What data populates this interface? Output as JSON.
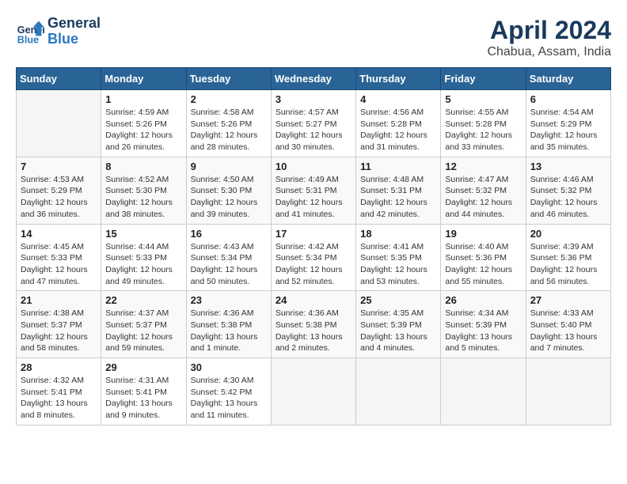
{
  "logo": {
    "line1": "General",
    "line2": "Blue"
  },
  "title": "April 2024",
  "subtitle": "Chabua, Assam, India",
  "days_header": [
    "Sunday",
    "Monday",
    "Tuesday",
    "Wednesday",
    "Thursday",
    "Friday",
    "Saturday"
  ],
  "weeks": [
    [
      {
        "num": "",
        "info": ""
      },
      {
        "num": "1",
        "info": "Sunrise: 4:59 AM\nSunset: 5:26 PM\nDaylight: 12 hours and 26 minutes."
      },
      {
        "num": "2",
        "info": "Sunrise: 4:58 AM\nSunset: 5:26 PM\nDaylight: 12 hours and 28 minutes."
      },
      {
        "num": "3",
        "info": "Sunrise: 4:57 AM\nSunset: 5:27 PM\nDaylight: 12 hours and 30 minutes."
      },
      {
        "num": "4",
        "info": "Sunrise: 4:56 AM\nSunset: 5:28 PM\nDaylight: 12 hours and 31 minutes."
      },
      {
        "num": "5",
        "info": "Sunrise: 4:55 AM\nSunset: 5:28 PM\nDaylight: 12 hours and 33 minutes."
      },
      {
        "num": "6",
        "info": "Sunrise: 4:54 AM\nSunset: 5:29 PM\nDaylight: 12 hours and 35 minutes."
      }
    ],
    [
      {
        "num": "7",
        "info": "Sunrise: 4:53 AM\nSunset: 5:29 PM\nDaylight: 12 hours and 36 minutes."
      },
      {
        "num": "8",
        "info": "Sunrise: 4:52 AM\nSunset: 5:30 PM\nDaylight: 12 hours and 38 minutes."
      },
      {
        "num": "9",
        "info": "Sunrise: 4:50 AM\nSunset: 5:30 PM\nDaylight: 12 hours and 39 minutes."
      },
      {
        "num": "10",
        "info": "Sunrise: 4:49 AM\nSunset: 5:31 PM\nDaylight: 12 hours and 41 minutes."
      },
      {
        "num": "11",
        "info": "Sunrise: 4:48 AM\nSunset: 5:31 PM\nDaylight: 12 hours and 42 minutes."
      },
      {
        "num": "12",
        "info": "Sunrise: 4:47 AM\nSunset: 5:32 PM\nDaylight: 12 hours and 44 minutes."
      },
      {
        "num": "13",
        "info": "Sunrise: 4:46 AM\nSunset: 5:32 PM\nDaylight: 12 hours and 46 minutes."
      }
    ],
    [
      {
        "num": "14",
        "info": "Sunrise: 4:45 AM\nSunset: 5:33 PM\nDaylight: 12 hours and 47 minutes."
      },
      {
        "num": "15",
        "info": "Sunrise: 4:44 AM\nSunset: 5:33 PM\nDaylight: 12 hours and 49 minutes."
      },
      {
        "num": "16",
        "info": "Sunrise: 4:43 AM\nSunset: 5:34 PM\nDaylight: 12 hours and 50 minutes."
      },
      {
        "num": "17",
        "info": "Sunrise: 4:42 AM\nSunset: 5:34 PM\nDaylight: 12 hours and 52 minutes."
      },
      {
        "num": "18",
        "info": "Sunrise: 4:41 AM\nSunset: 5:35 PM\nDaylight: 12 hours and 53 minutes."
      },
      {
        "num": "19",
        "info": "Sunrise: 4:40 AM\nSunset: 5:36 PM\nDaylight: 12 hours and 55 minutes."
      },
      {
        "num": "20",
        "info": "Sunrise: 4:39 AM\nSunset: 5:36 PM\nDaylight: 12 hours and 56 minutes."
      }
    ],
    [
      {
        "num": "21",
        "info": "Sunrise: 4:38 AM\nSunset: 5:37 PM\nDaylight: 12 hours and 58 minutes."
      },
      {
        "num": "22",
        "info": "Sunrise: 4:37 AM\nSunset: 5:37 PM\nDaylight: 12 hours and 59 minutes."
      },
      {
        "num": "23",
        "info": "Sunrise: 4:36 AM\nSunset: 5:38 PM\nDaylight: 13 hours and 1 minute."
      },
      {
        "num": "24",
        "info": "Sunrise: 4:36 AM\nSunset: 5:38 PM\nDaylight: 13 hours and 2 minutes."
      },
      {
        "num": "25",
        "info": "Sunrise: 4:35 AM\nSunset: 5:39 PM\nDaylight: 13 hours and 4 minutes."
      },
      {
        "num": "26",
        "info": "Sunrise: 4:34 AM\nSunset: 5:39 PM\nDaylight: 13 hours and 5 minutes."
      },
      {
        "num": "27",
        "info": "Sunrise: 4:33 AM\nSunset: 5:40 PM\nDaylight: 13 hours and 7 minutes."
      }
    ],
    [
      {
        "num": "28",
        "info": "Sunrise: 4:32 AM\nSunset: 5:41 PM\nDaylight: 13 hours and 8 minutes."
      },
      {
        "num": "29",
        "info": "Sunrise: 4:31 AM\nSunset: 5:41 PM\nDaylight: 13 hours and 9 minutes."
      },
      {
        "num": "30",
        "info": "Sunrise: 4:30 AM\nSunset: 5:42 PM\nDaylight: 13 hours and 11 minutes."
      },
      {
        "num": "",
        "info": ""
      },
      {
        "num": "",
        "info": ""
      },
      {
        "num": "",
        "info": ""
      },
      {
        "num": "",
        "info": ""
      }
    ]
  ]
}
